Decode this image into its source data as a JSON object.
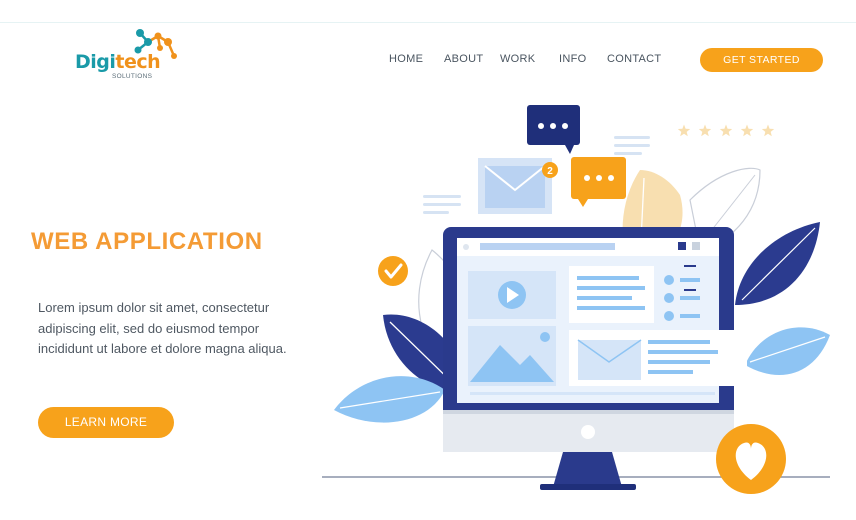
{
  "brand": {
    "name_part1": "Digi",
    "name_part2": "tech",
    "tagline": "SOLUTIONS",
    "colors": {
      "teal": "#1a9aa8",
      "orange": "#f0921c"
    },
    "icon": "molecule-logo-icon"
  },
  "nav": {
    "items": [
      "HOME",
      "ABOUT",
      "WORK",
      "INFO",
      "CONTACT"
    ],
    "cta_label": "GET STARTED"
  },
  "hero": {
    "title": "WEB APPLICATION",
    "body": "Lorem ipsum dolor sit amet, consectetur adipiscing elit, sed do eiusmod tempor incididunt ut labore et dolore magna aliqua.",
    "cta_label": "LEARN MORE",
    "accent_color": "#f7a21b"
  },
  "illustration": {
    "notification_count": "2",
    "rating_stars": 5,
    "icons": [
      "chat-bubble-icon",
      "mail-icon",
      "check-icon",
      "heart-icon",
      "play-icon",
      "image-icon",
      "star-icon"
    ]
  }
}
